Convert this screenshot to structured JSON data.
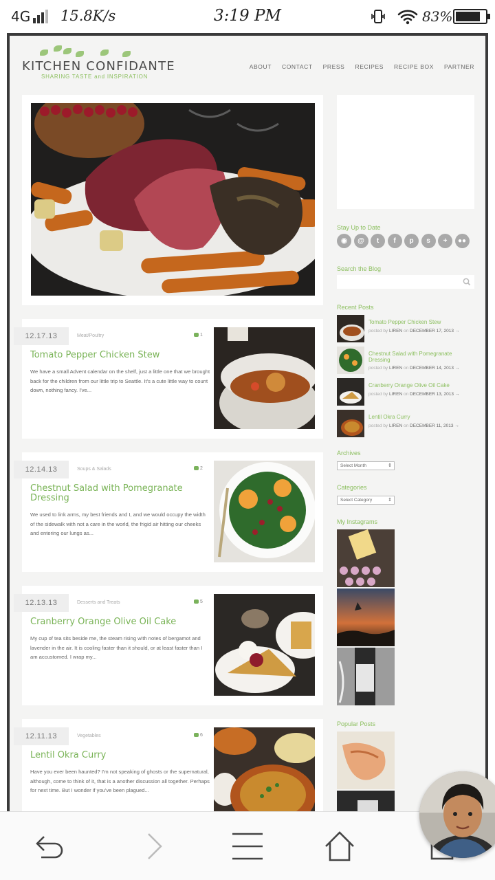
{
  "status_bar": {
    "network": "4G",
    "speed": "15.8K/s",
    "time": "3:19 PM",
    "battery": "83%"
  },
  "site": {
    "logo_name": "KITCHEN CONFIDANTE",
    "tagline": "SHARING TASTE and INSPIRATION",
    "nav": [
      "ABOUT",
      "CONTACT",
      "PRESS",
      "RECIPES",
      "RECIPE BOX",
      "PARTNER"
    ]
  },
  "posts": [
    {
      "date": "12.17.13",
      "category": "Meat/Poultry",
      "comments": "1",
      "title": "Tomato Pepper Chicken Stew",
      "excerpt": "We have a small Advent calendar on the shelf, just a little one that we brought back for the children from our little trip to Seattle. It's a cute little way to count down, nothing fancy. I've..."
    },
    {
      "date": "12.14.13",
      "category": "Soups & Salads",
      "comments": "2",
      "title": "Chestnut Salad with Pomegranate Dressing",
      "excerpt": "We used to link arms, my best friends and I, and we would occupy the width of the sidewalk with not a care in the world, the frigid air hitting our cheeks and entering our lungs as..."
    },
    {
      "date": "12.13.13",
      "category": "Desserts and Treats",
      "comments": "5",
      "title": "Cranberry Orange Olive Oil Cake",
      "excerpt": "My cup of tea sits beside me, the steam rising with notes of bergamot and lavender in the air. It is cooling faster than it should, or at least faster than I am accustomed. I wrap my..."
    },
    {
      "date": "12.11.13",
      "category": "Vegetables",
      "comments": "6",
      "title": "Lentil Okra Curry",
      "excerpt": "Have you ever been haunted? I'm not speaking of ghosts or the supernatural, although, come to think of it, that is a another discussion all together. Perhaps for next time. But I wonder if you've been plagued..."
    }
  ],
  "sidebar": {
    "stay_up": "Stay Up to Date",
    "social_icons": [
      "rss-icon",
      "email-icon",
      "twitter-icon",
      "facebook-icon",
      "pinterest-icon",
      "stumbleupon-icon",
      "googleplus-icon",
      "flickr-icon"
    ],
    "search_heading": "Search the Blog",
    "recent_heading": "Recent Posts",
    "recent": [
      {
        "title": "Tomato Pepper Chicken Stew",
        "prefix": "posted by",
        "author": "LIREN",
        "on": "on",
        "date": "DECEMBER 17, 2013 →"
      },
      {
        "title": "Chestnut Salad with Pomegranate Dressing",
        "prefix": "posted by",
        "author": "LIREN",
        "on": "on",
        "date": "DECEMBER 14, 2013 →"
      },
      {
        "title": "Cranberry Orange Olive Oil Cake",
        "prefix": "posted by",
        "author": "LIREN",
        "on": "on",
        "date": "DECEMBER 13, 2013 →"
      },
      {
        "title": "Lentil Okra Curry",
        "prefix": "posted by",
        "author": "LIREN",
        "on": "on",
        "date": "DECEMBER 11, 2013 →"
      }
    ],
    "archives_heading": "Archives",
    "archives_select": "Select Month",
    "categories_heading": "Categories",
    "categories_select": "Select Category",
    "instagram_heading": "My Instagrams",
    "popular_heading": "Popular Posts"
  },
  "bottom_bar": [
    "back-icon",
    "forward-icon",
    "menu-icon",
    "home-icon",
    "tabs-icon"
  ]
}
